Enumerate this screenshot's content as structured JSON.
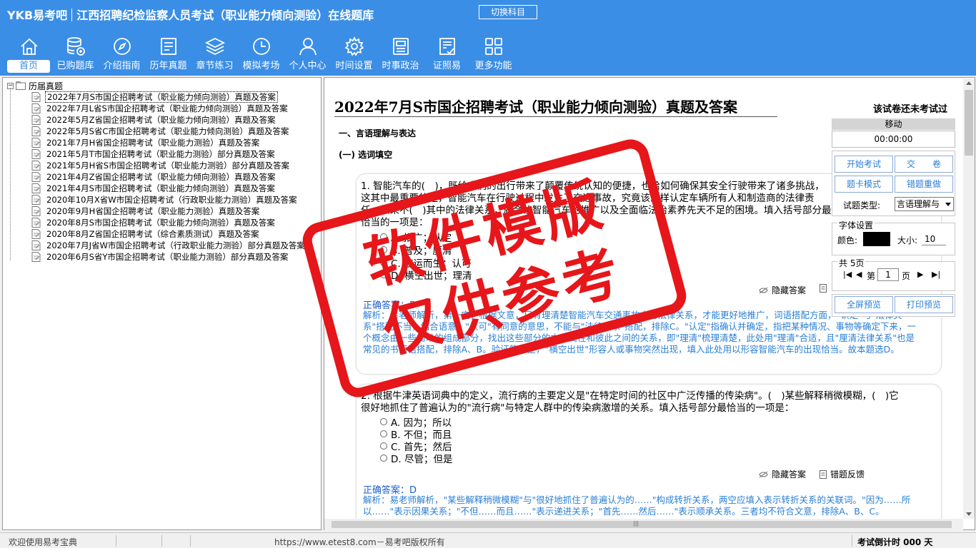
{
  "app": {
    "brand": "YKB易考吧",
    "title": "江西招聘纪检监察人员考试（职业能力倾向测验）在线题库",
    "switch_label": "切换科目"
  },
  "nav": [
    {
      "label": "首页",
      "icon": "home-icon"
    },
    {
      "label": "已购题库",
      "icon": "database-icon"
    },
    {
      "label": "介绍指南",
      "icon": "compass-icon"
    },
    {
      "label": "历年真题",
      "icon": "document-list-icon"
    },
    {
      "label": "章节练习",
      "icon": "layers-icon"
    },
    {
      "label": "模拟考场",
      "icon": "clock-icon"
    },
    {
      "label": "个人中心",
      "icon": "user-icon"
    },
    {
      "label": "时间设置",
      "icon": "gear-icon"
    },
    {
      "label": "时事政治",
      "icon": "news-icon"
    },
    {
      "label": "证照易",
      "icon": "certificate-icon"
    },
    {
      "label": "更多功能",
      "icon": "grid-icon"
    }
  ],
  "tree": {
    "root": "历届真题",
    "toggle": "−",
    "items": [
      "2022年7月S市国企招聘考试（职业能力倾向测验）真题及答案",
      "2022年7月L省S市国企招聘考试（职业能力倾向测验）真题及答案",
      "2022年5月Z省国企招聘考试（职业能力倾向测验）真题及答案",
      "2022年5月S省C市国企招聘考试（职业能力倾向测验）真题及答案",
      "2021年7月H省国企招聘考试（职业能力测验）真题及答案",
      "2021年5月T市国企招聘考试（职业能力测验）部分真题及答案",
      "2021年5月H省S市国企招聘考试（职业能力测验）部分真题及答案",
      "2021年4月Z省国企招聘考试（职业能力倾向测验）真题及答案",
      "2021年4月S市国企招聘考试（职业能力倾向测验）真题及答案",
      "2020年10月X省W市国企招聘考试（行政职业能力测验）真题及答案",
      "2020年9月H省国企招聘考试（职业能力测验）真题及答案",
      "2020年8月S市国企招聘考试（职业能力倾向测验）真题及答案",
      "2020年8月Z省国企招聘考试（综合素质测试）真题及答案",
      "2020年7月J省W市国企招聘考试（行政职业能力测验）部分真题及答案",
      "2020年6月S省Y市国企招聘考试（职业能力测验）部分真题及答案"
    ]
  },
  "exam": {
    "title": "2022年7月S市国企招聘考试（职业能力倾向测验）真题及答案",
    "status": "该试卷还未考试过",
    "section": "一、言语理解与表达",
    "subsection": "(一) 选词填空"
  },
  "q1": {
    "text": "1. 智能汽车的(　)，既给人们的出行带来了颠覆传统认知的便捷，也给如何确保其安全行驶带来了诸多挑战，这其中最重要的是，智能汽车在行驶过程中发生了交通事故，究竟该怎样认定车辆所有人和制造商的法律责任。如果不(　)其中的法律关系，就会让智能汽车的推广以及全面临法治素养先天不足的困境。填入括号部分最恰当的一项是：",
    "options": [
      "A. 推广；认定",
      "B. 普及；厘清",
      "C. 应运而生；认可",
      "D. 横空出世；理清"
    ],
    "answer": "正确答案：D",
    "explanation": "解析：易老师解析，第一空，根据文意，只有理清楚智能汽车交通事故中的法律关系，才能更好地推广，词语搭配方面，\"认定\"与\"法律关系\"搭配不当，结合语意，\"认可\"有同意的意思，不能与\"法律关系\"搭配，排除C。\"认定\"指确认并确定，指把某种情况、事物等确定下来，一个概念由一些简单的组成部分，找出这些部分的本质属性和彼此之间的关系，即\"理清\"梳理清楚，此处用\"理清\"合适，且\"厘清法律关系\"也是常见的书面语搭配，排除A、B。验证第一空，\"横空出世\"形容人或事物突然出现，填入此处用以形容智能汽车的出现恰当。故本题选D。",
    "hide_answer": "隐藏答案",
    "feedback": "错题反馈"
  },
  "q2": {
    "text": "2. 根据牛津英语词典中的定义，流行病的主要定义是\"在特定时间的社区中广泛传播的传染病\"。(　)某些解释稍微模糊，(　)它很好地抓住了普遍认为的\"流行病\"与特定人群中的传染病激增的关系。填入括号部分最恰当的一项是：",
    "options": [
      "A. 因为；所以",
      "B. 不但；而且",
      "C. 首先；然后",
      "D. 尽管；但是"
    ],
    "answer": "正确答案：D",
    "explanation": "解析：易老师解析，\"某些解释稍微模糊\"与\"很好地抓住了普遍认为的……\"构成转折关系，两空应填入表示转折关系的关联词。\"因为……所以……\"表示因果关系；\"不但……而且……\"表示递进关系；\"首先……然后……\"表示顺承关系。三者均不符合文意，排除A、B、C。",
    "hide_answer": "隐藏答案",
    "feedback": "错题反馈"
  },
  "side": {
    "move": "移动",
    "timer": "00:00:00",
    "start_exam": "开始考试",
    "submit": "交　　卷",
    "card_mode": "题卡模式",
    "redo_wrong": "错题重做",
    "type_label": "试题类型:",
    "type_value": "言语理解与",
    "font_label": "字体设置",
    "color_label": "颜色:",
    "size_label": "大小:",
    "size_value": "10",
    "pages_label": "共 5页",
    "first": "|◀",
    "prev": "◀",
    "page_prefix": "第",
    "page_value": "1",
    "page_suffix": "页",
    "next": "▶",
    "last": "▶|",
    "fullscreen": "全屏预览",
    "print": "打印预览",
    "font_color": "#000000"
  },
  "status": {
    "welcome": "欢迎使用易考宝典",
    "copyright": "https://www.etest8.com－易考吧版权所有",
    "countdown": "考试倒计时 000 天"
  },
  "watermark": {
    "line1": "软件模版",
    "line2": "仅供参考"
  },
  "colors": {
    "brand_blue": "#3a8ee6",
    "stamp_red": "#e6161a",
    "answer_blue": "#1c5fd0",
    "explain_blue": "#2a7fd4"
  }
}
